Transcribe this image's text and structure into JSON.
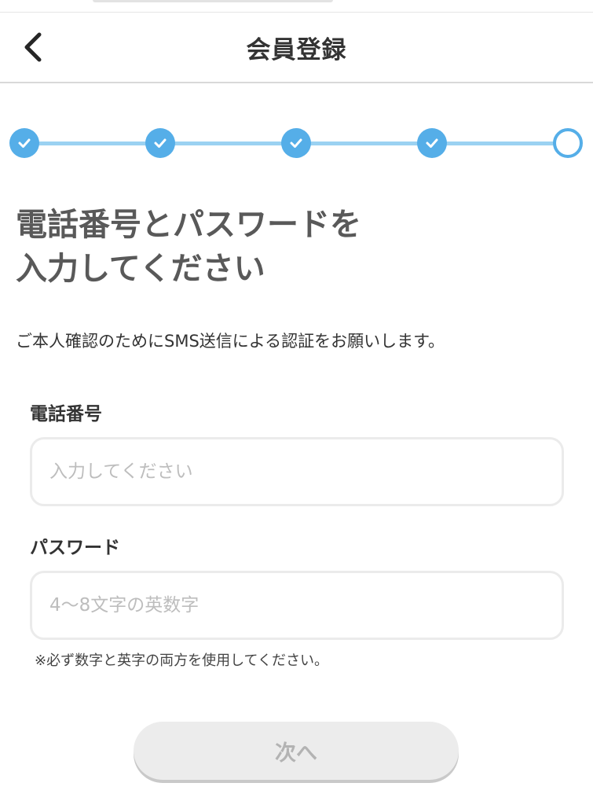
{
  "header": {
    "title": "会員登録",
    "back_icon": "chevron-left-icon"
  },
  "stepper": {
    "total_steps": 5,
    "current_step": 5,
    "completed_icon": "check-icon",
    "active_color": "#55aee8",
    "line_color": "#9bd2f2"
  },
  "content": {
    "headline_line1": "電話番号とパスワードを",
    "headline_line2": "入力してください",
    "description": "ご本人確認のためにSMS送信による認証をお願いします。"
  },
  "form": {
    "phone": {
      "label": "電話番号",
      "value": "",
      "placeholder": "入力してください"
    },
    "password": {
      "label": "パスワード",
      "value": "",
      "placeholder": "4〜8文字の英数字"
    },
    "note": "※必ず数字と英字の両方を使用してください。"
  },
  "actions": {
    "next_label": "次へ",
    "next_enabled": false
  }
}
